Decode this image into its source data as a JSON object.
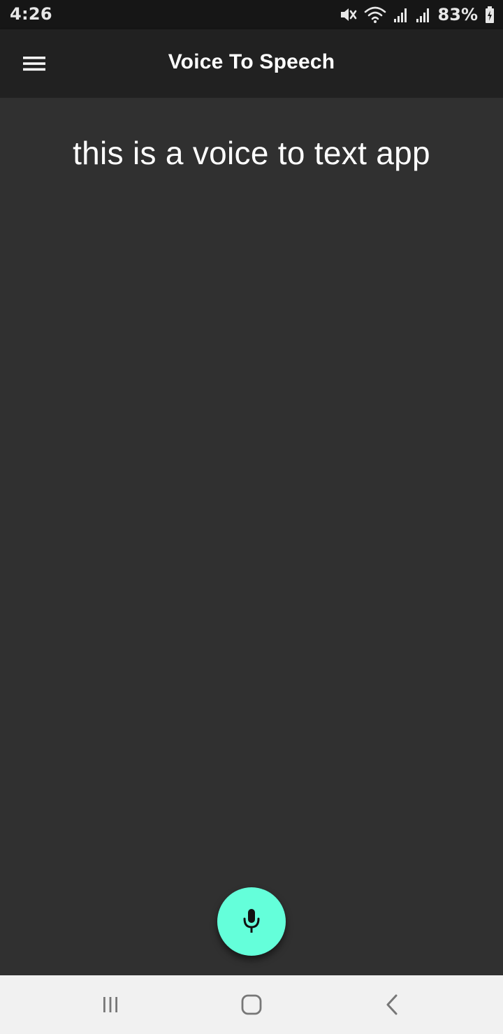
{
  "status_bar": {
    "time": "4:26",
    "battery": "83%",
    "icons": [
      "mute-icon",
      "wifi-icon",
      "signal-icon",
      "signal-icon",
      "battery-icon"
    ]
  },
  "app_bar": {
    "title": "Voice To Speech",
    "menu_icon": "hamburger-menu-icon"
  },
  "content": {
    "transcript": "this is a voice to text app"
  },
  "fab": {
    "icon": "microphone-icon"
  },
  "nav_bar": {
    "buttons": [
      "recent-apps-icon",
      "home-icon",
      "back-icon"
    ]
  },
  "colors": {
    "background": "#303030",
    "app_bar": "#212121",
    "status_bar": "#161616",
    "fab": "#64ffda",
    "nav_bar": "#f1f1f1"
  }
}
